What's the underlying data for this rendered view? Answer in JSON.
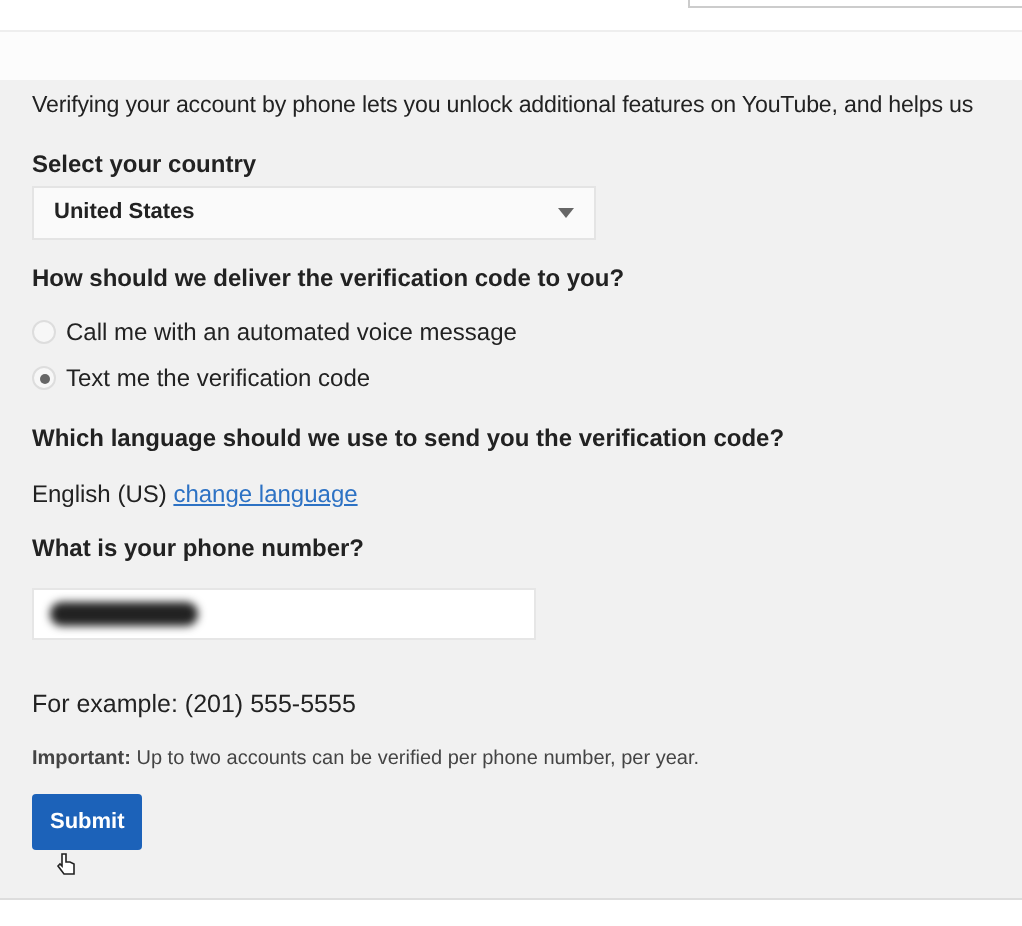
{
  "intro": "Verifying your account by phone lets you unlock additional features on YouTube, and helps us",
  "country": {
    "label": "Select your country",
    "value": "United States"
  },
  "delivery": {
    "label": "How should we deliver the verification code to you?",
    "options": [
      {
        "label": "Call me with an automated voice message",
        "selected": false
      },
      {
        "label": "Text me the verification code",
        "selected": true
      }
    ]
  },
  "language": {
    "label": "Which language should we use to send you the verification code?",
    "value": "English (US)",
    "link": "change language"
  },
  "phone": {
    "label": "What is your phone number?",
    "example": "For example: (201) 555-5555"
  },
  "note": "**Important:** Up to two accounts can be verified per phone number, per year.",
  "submit": "Submit"
}
